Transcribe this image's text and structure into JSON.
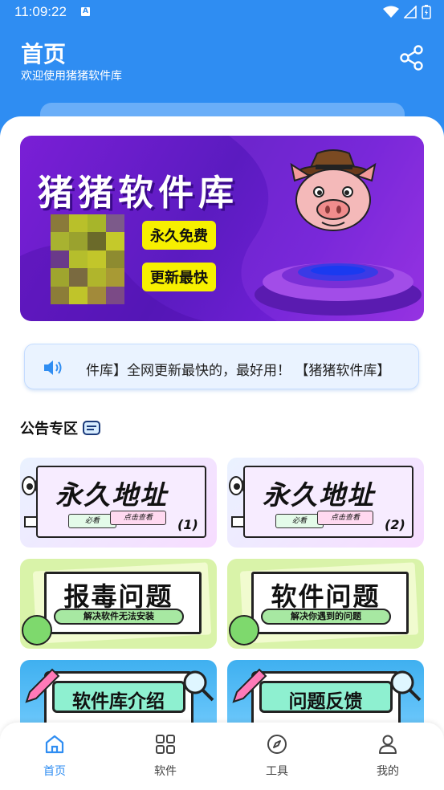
{
  "status": {
    "time": "11:09:22",
    "notification_letter": "A"
  },
  "header": {
    "title": "首页",
    "subtitle": "欢迎使用猪猪软件库"
  },
  "banner": {
    "title": "猪猪软件库",
    "badges": [
      "永久免费",
      "更新最快"
    ]
  },
  "notice": {
    "text": "件库】全网更新最快的，最好用！ 【猪猪软件库】"
  },
  "section": {
    "title": "公告专区"
  },
  "cards": [
    {
      "title": "永久地址",
      "tag1": "必看",
      "tag2": "点击查看",
      "number": "(1)"
    },
    {
      "title": "永久地址",
      "tag1": "必看",
      "tag2": "点击查看",
      "number": "(2)"
    },
    {
      "title": "报毒问题",
      "subtitle": "解决软件无法安装"
    },
    {
      "title": "软件问题",
      "subtitle": "解决你遇到的问题"
    },
    {
      "title": "软件库介绍"
    },
    {
      "title": "问题反馈"
    }
  ],
  "nav": {
    "items": [
      {
        "label": "首页",
        "icon": "home-icon",
        "active": true
      },
      {
        "label": "软件",
        "icon": "grid-icon",
        "active": false
      },
      {
        "label": "工具",
        "icon": "compass-icon",
        "active": false
      },
      {
        "label": "我的",
        "icon": "user-icon",
        "active": false
      }
    ]
  },
  "colors": {
    "primary": "#2f8df2",
    "badge": "#f7f000",
    "banner": "#6a1fd0"
  }
}
